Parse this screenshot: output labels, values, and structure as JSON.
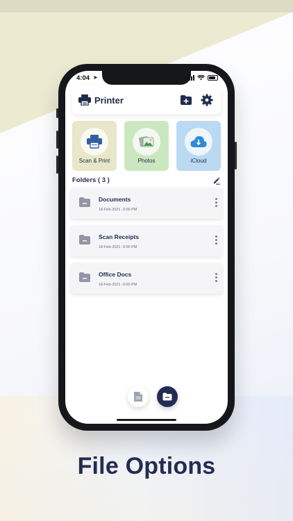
{
  "status_bar": {
    "time": "4:04"
  },
  "header": {
    "title": "Printer"
  },
  "tiles": [
    {
      "label": "Scan & Print",
      "color": "#e9e6c9"
    },
    {
      "label": "Photos",
      "color": "#cbe7bf"
    },
    {
      "label": "iCloud",
      "color": "#bcd9f2"
    }
  ],
  "folders": {
    "heading": "Folders ( 3 )",
    "items": [
      {
        "name": "Documents",
        "date": "18-Feb-2021 -3:00 PM"
      },
      {
        "name": "Scan Receipts",
        "date": "18-Feb-2021 -3:00 PM"
      },
      {
        "name": "Office Docs",
        "date": "18-Feb-2021 -3:00 PM"
      }
    ]
  },
  "bottom_actions": [
    {
      "icon": "document-icon"
    },
    {
      "icon": "folder-icon"
    }
  ],
  "caption": "File Options",
  "colors": {
    "brand_navy": "#232c52",
    "accent_blue": "#2f8ad6"
  }
}
